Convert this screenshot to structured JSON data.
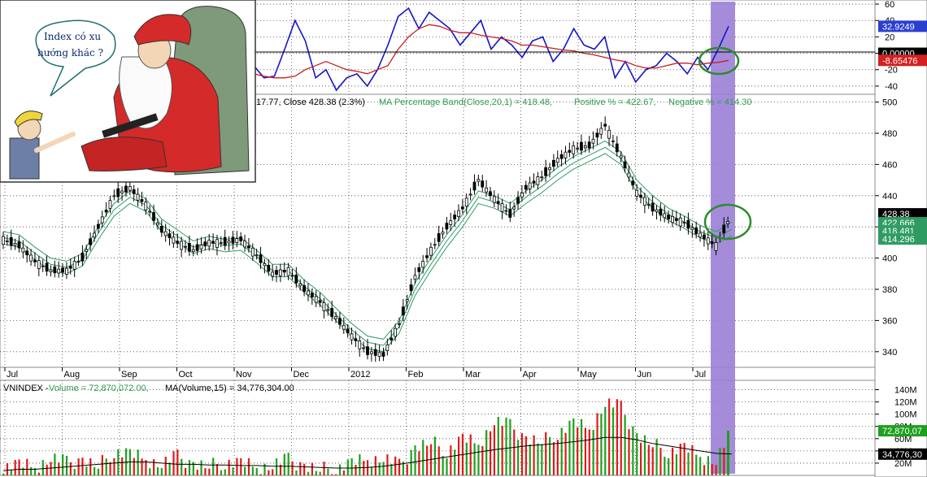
{
  "cartoon": {
    "speech_line1": "Index có xu",
    "speech_line2": "hướng khác ?"
  },
  "price_header": {
    "lead": "17.77, Close 428.38 (2.3%)",
    "band": "MA Percentage Band(Close,20,1) = 418.48,",
    "positive": "Positive % = 422.67,",
    "negative": "Negative % = 414.30"
  },
  "volume_header": {
    "name": "VNINDEX -",
    "volume": "Volume = 72,870,072.00,",
    "ma": "MA(Volume,15) = 34,776,304.00"
  },
  "colors": {
    "oscillator": "#1515c8",
    "signal": "#c81e1e",
    "band": "#2e9c62",
    "candle": "#000000",
    "vol_up": "#1ea01e",
    "vol_down": "#e01a1a",
    "highlight": "#9b7fd6",
    "circle": "#2e8b2e"
  },
  "oscillator_axis": {
    "ticks": [
      "60",
      "40",
      "20",
      "0",
      "-20",
      "-40"
    ]
  },
  "price_axis": {
    "ticks": [
      "500",
      "480",
      "460",
      "440",
      "420",
      "400",
      "380",
      "360",
      "340"
    ]
  },
  "volume_axis": {
    "ticks": [
      "140M",
      "120M",
      "100M",
      "80M",
      "60M",
      "40M",
      "20M"
    ]
  },
  "value_tags": {
    "osc": "32.9249",
    "zero": "0.00000",
    "signal": "-8.65476",
    "close": "428.38",
    "positive": "422.666",
    "band": "418.481",
    "negative": "414.296",
    "vol": "72,870,07",
    "vol_ma": "34,776,30"
  },
  "x_labels": [
    "Jul",
    "Aug",
    "Sep",
    "Oct",
    "Nov",
    "Dec",
    "2012",
    "Feb",
    "Mar",
    "Apr",
    "May",
    "Jun",
    "Jul"
  ],
  "chart_data": [
    {
      "type": "line",
      "ylim": [
        -50,
        65
      ],
      "series": [
        {
          "values": [
            -15,
            -30,
            -28,
            5,
            40,
            15,
            -30,
            -20,
            -45,
            -30,
            -25,
            -40,
            -20,
            10,
            45,
            55,
            30,
            50,
            40,
            30,
            10,
            25,
            40,
            5,
            20,
            10,
            -5,
            15,
            20,
            -10,
            5,
            30,
            10,
            5,
            20,
            -30,
            -10,
            -35,
            -20,
            -15,
            0,
            -10,
            -25,
            -5,
            -20,
            5,
            33
          ]
        },
        {
          "values": [
            -25,
            -28,
            -30,
            -30,
            -28,
            -20,
            -15,
            -10,
            -15,
            -20,
            -22,
            -25,
            -20,
            -15,
            5,
            20,
            30,
            35,
            33,
            28,
            25,
            25,
            22,
            20,
            18,
            15,
            10,
            10,
            8,
            6,
            4,
            3,
            0,
            -2,
            -5,
            -8,
            -10,
            -15,
            -18,
            -18,
            -15,
            -12,
            -12,
            -14,
            -12,
            -11,
            -8.65
          ]
        }
      ]
    },
    {
      "type": "line",
      "ylim": [
        330,
        505
      ],
      "series": [
        {
          "values": [
            412,
            408,
            398,
            392,
            392,
            400,
            420,
            440,
            445,
            434,
            418,
            410,
            405,
            410,
            410,
            412,
            402,
            390,
            392,
            380,
            372,
            362,
            350,
            340,
            338,
            358,
            388,
            405,
            420,
            432,
            450,
            438,
            428,
            445,
            452,
            463,
            470,
            472,
            485,
            465,
            442,
            432,
            426,
            423,
            415,
            408,
            428
          ]
        },
        {
          "values": [
            417,
            415,
            407,
            400,
            398,
            403,
            420,
            435,
            443,
            438,
            425,
            418,
            411,
            414,
            412,
            413,
            405,
            396,
            396,
            386,
            378,
            368,
            358,
            350,
            348,
            360,
            384,
            400,
            415,
            428,
            443,
            440,
            435,
            443,
            450,
            458,
            465,
            470,
            475,
            468,
            450,
            440,
            432,
            427,
            421,
            417,
            423
          ]
        },
        {
          "values": [
            413,
            411,
            403,
            396,
            394,
            399,
            416,
            431,
            439,
            434,
            421,
            414,
            407,
            410,
            408,
            409,
            401,
            392,
            392,
            382,
            374,
            364,
            354,
            346,
            344,
            356,
            380,
            396,
            411,
            424,
            439,
            436,
            431,
            439,
            446,
            454,
            461,
            466,
            471,
            464,
            446,
            436,
            428,
            423,
            417,
            413,
            418.5
          ]
        },
        {
          "values": [
            409,
            407,
            399,
            392,
            390,
            395,
            412,
            427,
            435,
            430,
            417,
            410,
            403,
            406,
            404,
            405,
            397,
            388,
            388,
            378,
            370,
            360,
            350,
            342,
            340,
            352,
            376,
            392,
            407,
            420,
            435,
            432,
            427,
            435,
            442,
            450,
            457,
            462,
            467,
            460,
            442,
            432,
            424,
            419,
            413,
            409,
            414.3
          ]
        }
      ]
    },
    {
      "type": "bar",
      "ylim": [
        0,
        150
      ],
      "series": [
        {
          "values": [
            15,
            18,
            12,
            30,
            20,
            25,
            15,
            40,
            35,
            25,
            20,
            30,
            18,
            15,
            22,
            20,
            12,
            18,
            25,
            15,
            10,
            12,
            20,
            25,
            30,
            15,
            45,
            55,
            40,
            60,
            50,
            90,
            80,
            60,
            55,
            70,
            85,
            75,
            120,
            110,
            65,
            50,
            40,
            45,
            30,
            25,
            72.87
          ]
        },
        {
          "values": [
            8,
            10,
            10,
            12,
            14,
            16,
            18,
            20,
            22,
            22,
            20,
            18,
            18,
            17,
            17,
            16,
            16,
            15,
            15,
            14,
            13,
            12,
            12,
            13,
            15,
            18,
            22,
            26,
            30,
            34,
            38,
            42,
            45,
            48,
            50,
            52,
            55,
            58,
            62,
            62,
            58,
            52,
            48,
            44,
            40,
            36,
            34.78
          ]
        }
      ]
    }
  ]
}
